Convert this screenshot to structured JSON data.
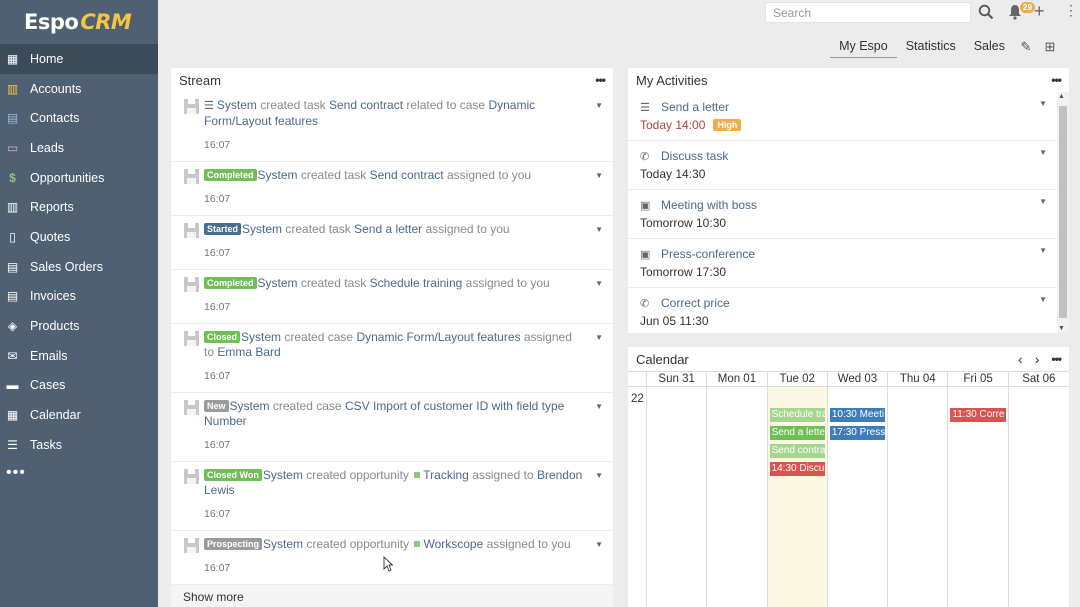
{
  "brand": {
    "espo": "Espo",
    "crm": "CRM"
  },
  "sidebar": {
    "items": [
      {
        "label": "Home",
        "icon": "home-grid-icon",
        "glyph": "▦",
        "active": true
      },
      {
        "label": "Accounts",
        "icon": "building-icon",
        "glyph": "▥"
      },
      {
        "label": "Contacts",
        "icon": "contact-card-icon",
        "glyph": "▤"
      },
      {
        "label": "Leads",
        "icon": "id-card-icon",
        "glyph": "▭"
      },
      {
        "label": "Opportunities",
        "icon": "dollar-icon",
        "glyph": "$"
      },
      {
        "label": "Reports",
        "icon": "bar-chart-icon",
        "glyph": "▥"
      },
      {
        "label": "Quotes",
        "icon": "file-icon",
        "glyph": "▯"
      },
      {
        "label": "Sales Orders",
        "icon": "file-text-icon",
        "glyph": "▤"
      },
      {
        "label": "Invoices",
        "icon": "invoice-icon",
        "glyph": "▤"
      },
      {
        "label": "Products",
        "icon": "cube-icon",
        "glyph": "◈"
      },
      {
        "label": "Emails",
        "icon": "envelope-icon",
        "glyph": "✉"
      },
      {
        "label": "Cases",
        "icon": "briefcase-icon",
        "glyph": "▬"
      },
      {
        "label": "Calendar",
        "icon": "calendar-icon",
        "glyph": "▦"
      },
      {
        "label": "Tasks",
        "icon": "task-list-icon",
        "glyph": "☰"
      }
    ],
    "more": "•••"
  },
  "topbar": {
    "search_placeholder": "Search",
    "notifications_count": "29"
  },
  "tabs": [
    "My Espo",
    "Statistics",
    "Sales"
  ],
  "stream": {
    "title": "Stream",
    "items": [
      {
        "label": "",
        "actor": "System",
        "verb": "created task",
        "target": "Send contract",
        "rest": "related to case",
        "extra": "Dynamic Form/Layout features",
        "time": "16:07"
      },
      {
        "label": "Completed",
        "actor": "System",
        "verb": "created task",
        "target": "Send contract",
        "rest": "assigned to you",
        "time": "16:07"
      },
      {
        "label": "Started",
        "actor": "System",
        "verb": "created task",
        "target": "Send a letter",
        "rest": "assigned to you",
        "time": "16:07"
      },
      {
        "label": "Completed",
        "actor": "System",
        "verb": "created task",
        "target": "Schedule training",
        "rest": "assigned to you",
        "time": "16:07"
      },
      {
        "label": "Closed",
        "actor": "System",
        "verb": "created case",
        "target": "Dynamic Form/Layout features",
        "rest": "assigned to",
        "extra": "Emma Bard",
        "time": "16:07"
      },
      {
        "label": "New",
        "actor": "System",
        "verb": "created case",
        "target": "CSV Import of customer ID with field type Number",
        "time": "16:07"
      },
      {
        "label": "Closed Won",
        "actor": "System",
        "verb": "created opportunity",
        "target": "Tracking",
        "rest": "assigned to",
        "extra": "Brendon Lewis",
        "time": "16:07"
      },
      {
        "label": "Prospecting",
        "actor": "System",
        "verb": "created opportunity",
        "target": "Workscope",
        "rest": "assigned to you",
        "time": "16:07"
      }
    ],
    "show_more": "Show more"
  },
  "activities": {
    "title": "My Activities",
    "items": [
      {
        "icon": "task-list-icon",
        "glyph": "☰",
        "name": "Send a letter",
        "when": "Today 14:00",
        "late": true,
        "priority": "High"
      },
      {
        "icon": "phone-icon",
        "glyph": "✆",
        "name": "Discuss task",
        "when": "Today 14:30"
      },
      {
        "icon": "calendar-check-icon",
        "glyph": "▣",
        "name": "Meeting with boss",
        "when": "Tomorrow 10:30"
      },
      {
        "icon": "calendar-check-icon",
        "glyph": "▣",
        "name": "Press-conference",
        "when": "Tomorrow 17:30"
      },
      {
        "icon": "phone-icon",
        "glyph": "✆",
        "name": "Correct price",
        "when": "Jun 05 11:30"
      }
    ]
  },
  "calendar": {
    "title": "Calendar",
    "days": [
      "Sun 31",
      "Mon 01",
      "Tue 02",
      "Wed 03",
      "Thu 04",
      "Fri 05",
      "Sat 06"
    ],
    "row_label": "22",
    "events": {
      "tue": [
        {
          "text": "Schedule tra",
          "color": "lgreen"
        },
        {
          "text": "Send a lette",
          "color": "green"
        },
        {
          "text": "Send contra",
          "color": "lgreen"
        },
        {
          "text": "14:30 Discus",
          "color": "red"
        }
      ],
      "wed": [
        {
          "text": "10:30 Meeti",
          "color": "blue"
        },
        {
          "text": "17:30 Press-",
          "color": "blue"
        }
      ],
      "fri": [
        {
          "text": "11:30 Corre",
          "color": "red"
        }
      ]
    }
  }
}
